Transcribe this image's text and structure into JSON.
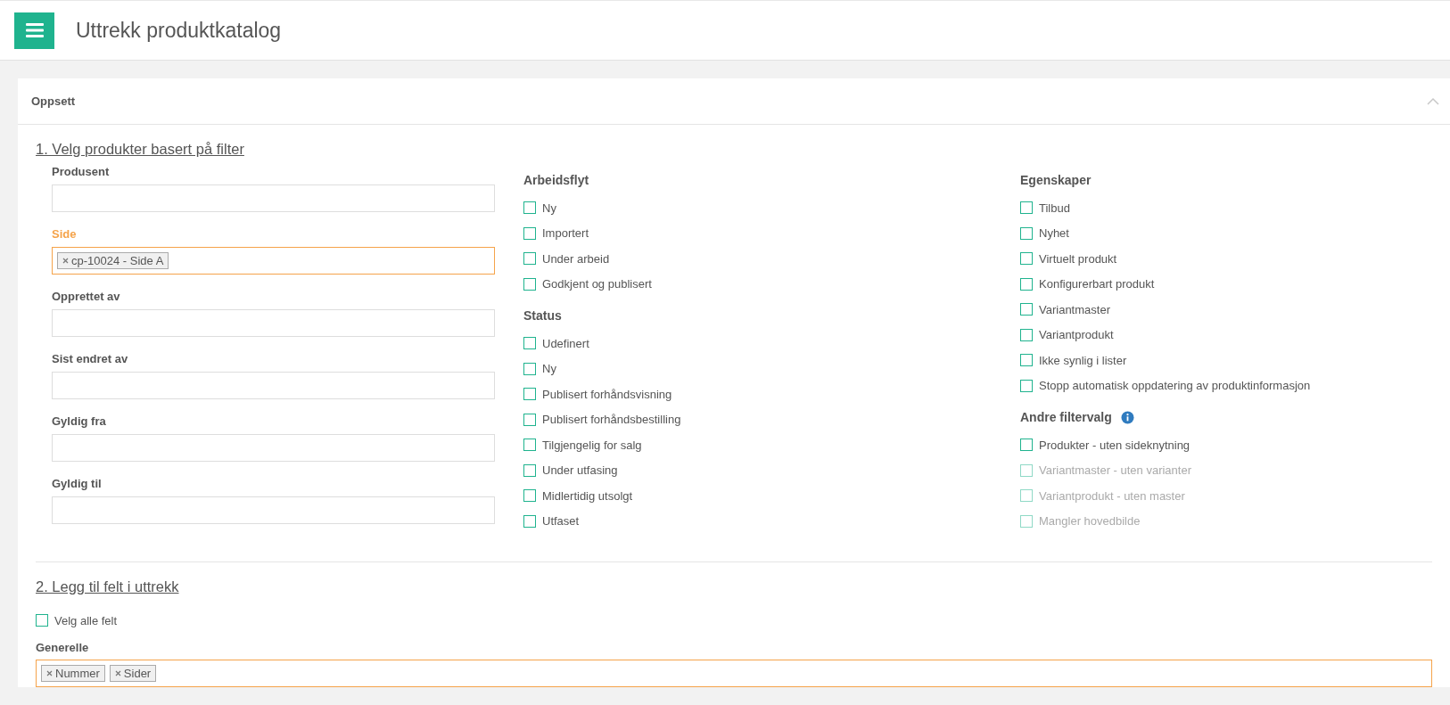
{
  "header": {
    "title": "Uttrekk produktkatalog"
  },
  "panel": {
    "title": "Oppsett",
    "expanded": true
  },
  "section1": {
    "heading": "1. Velg produkter basert på filter",
    "fields": [
      {
        "label": "Produsent",
        "focused": false
      },
      {
        "label": "Side",
        "focused": true,
        "tags": [
          "cp-10024 - Side A"
        ]
      },
      {
        "label": "Opprettet av",
        "focused": false
      },
      {
        "label": "Sist endret av",
        "focused": false
      },
      {
        "label": "Gyldig fra",
        "focused": false
      },
      {
        "label": "Gyldig til",
        "focused": false
      }
    ],
    "columns": [
      [
        {
          "heading": "Arbeidsflyt",
          "info": false,
          "options": [
            {
              "label": "Ny",
              "checked": false,
              "disabled": false
            },
            {
              "label": "Importert",
              "checked": false,
              "disabled": false
            },
            {
              "label": "Under arbeid",
              "checked": false,
              "disabled": false
            },
            {
              "label": "Godkjent og publisert",
              "checked": false,
              "disabled": false
            }
          ]
        },
        {
          "heading": "Status",
          "info": false,
          "options": [
            {
              "label": "Udefinert",
              "checked": false,
              "disabled": false
            },
            {
              "label": "Ny",
              "checked": false,
              "disabled": false
            },
            {
              "label": "Publisert forhåndsvisning",
              "checked": false,
              "disabled": false
            },
            {
              "label": "Publisert forhåndsbestilling",
              "checked": false,
              "disabled": false
            },
            {
              "label": "Tilgjengelig for salg",
              "checked": false,
              "disabled": false
            },
            {
              "label": "Under utfasing",
              "checked": false,
              "disabled": false
            },
            {
              "label": "Midlertidig utsolgt",
              "checked": false,
              "disabled": false
            },
            {
              "label": "Utfaset",
              "checked": false,
              "disabled": false
            }
          ]
        }
      ],
      [
        {
          "heading": "Egenskaper",
          "info": false,
          "options": [
            {
              "label": "Tilbud",
              "checked": false,
              "disabled": false
            },
            {
              "label": "Nyhet",
              "checked": false,
              "disabled": false
            },
            {
              "label": "Virtuelt produkt",
              "checked": false,
              "disabled": false
            },
            {
              "label": "Konfigurerbart produkt",
              "checked": false,
              "disabled": false
            },
            {
              "label": "Variantmaster",
              "checked": false,
              "disabled": false
            },
            {
              "label": "Variantprodukt",
              "checked": false,
              "disabled": false
            },
            {
              "label": "Ikke synlig i lister",
              "checked": false,
              "disabled": false
            },
            {
              "label": "Stopp automatisk oppdatering av produktinformasjon",
              "checked": false,
              "disabled": false
            }
          ]
        },
        {
          "heading": "Andre filtervalg",
          "info": true,
          "options": [
            {
              "label": "Produkter - uten sideknytning",
              "checked": false,
              "disabled": false
            },
            {
              "label": "Variantmaster - uten varianter",
              "checked": false,
              "disabled": true
            },
            {
              "label": "Variantprodukt - uten master",
              "checked": false,
              "disabled": true
            },
            {
              "label": "Mangler hovedbilde",
              "checked": false,
              "disabled": true
            }
          ]
        }
      ]
    ]
  },
  "section2": {
    "heading": "2. Legg til felt i uttrekk",
    "select_all": {
      "label": "Velg alle felt",
      "checked": false,
      "disabled": false
    },
    "field": {
      "label": "Generelle",
      "focused": true,
      "tags": [
        "Nummer",
        "Sider"
      ]
    }
  }
}
